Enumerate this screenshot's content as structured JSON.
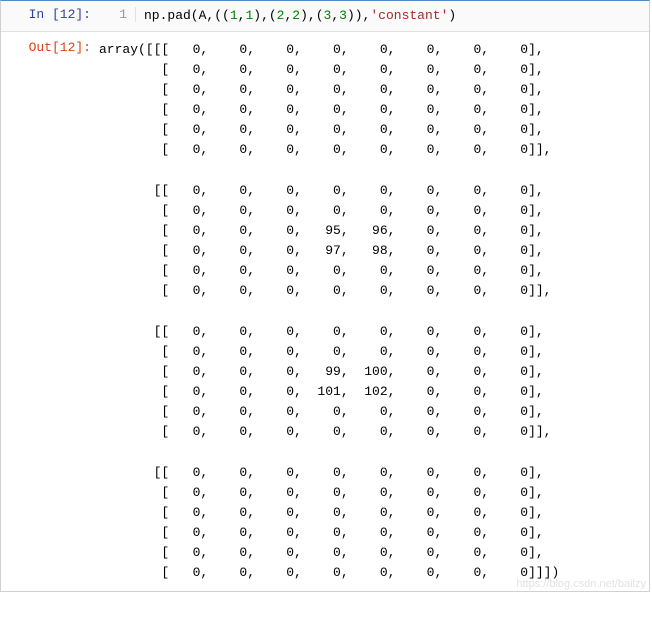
{
  "input": {
    "prompt": "In [12]:",
    "line_number": "1",
    "code_parts": {
      "p1": "np.pad(A,((",
      "n1": "1",
      "c1": ",",
      "n2": "1",
      "c2": "),(",
      "n3": "2",
      "c3": ",",
      "n4": "2",
      "c4": "),(",
      "n5": "3",
      "c5": ",",
      "n6": "3",
      "c6": ")),",
      "s1": "'constant'",
      "c7": ")"
    }
  },
  "output": {
    "prompt": "Out[12]:",
    "text": "array([[[   0,    0,    0,    0,    0,    0,    0,    0],\n        [   0,    0,    0,    0,    0,    0,    0,    0],\n        [   0,    0,    0,    0,    0,    0,    0,    0],\n        [   0,    0,    0,    0,    0,    0,    0,    0],\n        [   0,    0,    0,    0,    0,    0,    0,    0],\n        [   0,    0,    0,    0,    0,    0,    0,    0]],\n\n       [[   0,    0,    0,    0,    0,    0,    0,    0],\n        [   0,    0,    0,    0,    0,    0,    0,    0],\n        [   0,    0,    0,   95,   96,    0,    0,    0],\n        [   0,    0,    0,   97,   98,    0,    0,    0],\n        [   0,    0,    0,    0,    0,    0,    0,    0],\n        [   0,    0,    0,    0,    0,    0,    0,    0]],\n\n       [[   0,    0,    0,    0,    0,    0,    0,    0],\n        [   0,    0,    0,    0,    0,    0,    0,    0],\n        [   0,    0,    0,   99,  100,    0,    0,    0],\n        [   0,    0,    0,  101,  102,    0,    0,    0],\n        [   0,    0,    0,    0,    0,    0,    0,    0],\n        [   0,    0,    0,    0,    0,    0,    0,    0]],\n\n       [[   0,    0,    0,    0,    0,    0,    0,    0],\n        [   0,    0,    0,    0,    0,    0,    0,    0],\n        [   0,    0,    0,    0,    0,    0,    0,    0],\n        [   0,    0,    0,    0,    0,    0,    0,    0],\n        [   0,    0,    0,    0,    0,    0,    0,    0],\n        [   0,    0,    0,    0,    0,    0,    0,    0]]])"
  },
  "watermark": "https://blog.csdn.net/bailzy"
}
